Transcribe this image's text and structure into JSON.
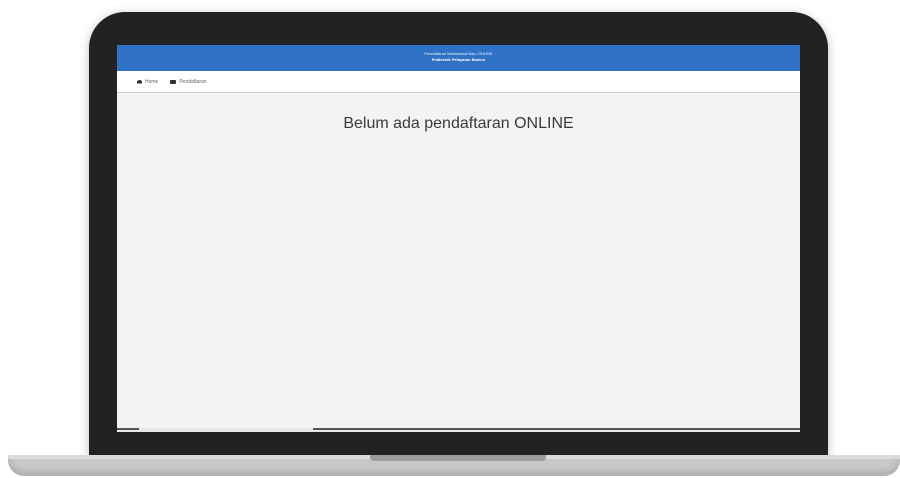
{
  "header": {
    "title": "Pendaftaran Mahasiswa Baru ONLINE",
    "subtitle": "Politeknik Pelayaran Banten"
  },
  "nav": {
    "items": [
      {
        "label": "Home",
        "icon": "home-icon"
      },
      {
        "label": "Pendaftaran",
        "icon": "form-icon"
      }
    ]
  },
  "main": {
    "message": "Belum ada pendaftaran ONLINE"
  },
  "colors": {
    "header_blue": "#2f71c4",
    "bezel": "#222222",
    "screen_bg": "#f3f3f3"
  }
}
